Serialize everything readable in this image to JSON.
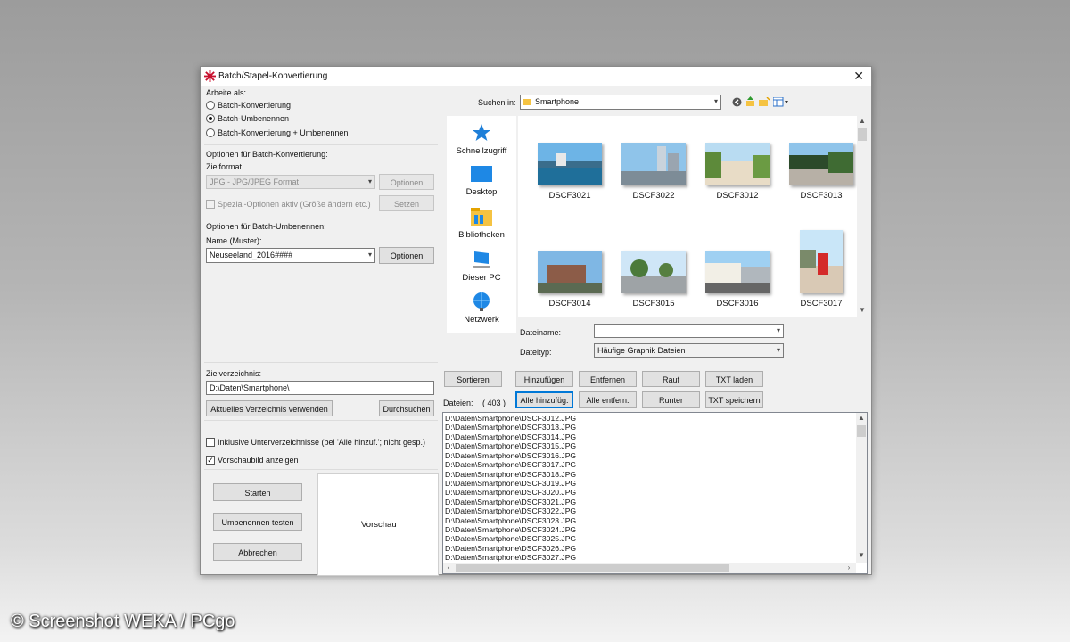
{
  "window": {
    "title": "Batch/Stapel-Konvertierung"
  },
  "mode": {
    "label": "Arbeite als:",
    "options": [
      "Batch-Konvertierung",
      "Batch-Umbenennen",
      "Batch-Konvertierung + Umbenennen"
    ],
    "selected": "Batch-Umbenennen"
  },
  "conversion": {
    "group_label": "Optionen für Batch-Konvertierung:",
    "format_label": "Zielformat",
    "format_value": "JPG - JPG/JPEG Format",
    "options_button": "Optionen",
    "special_label": "Spezial-Optionen aktiv (Größe ändern etc.)",
    "set_button": "Setzen"
  },
  "rename": {
    "group_label": "Optionen für Batch-Umbenennen:",
    "name_label": "Name (Muster):",
    "name_value": "Neuseeland_2016####",
    "options_button": "Optionen"
  },
  "target": {
    "label": "Zielverzeichnis:",
    "path": "D:\\Daten\\Smartphone\\",
    "use_current_button": "Aktuelles Verzeichnis verwenden",
    "browse_button": "Durchsuchen"
  },
  "checkboxes": {
    "include_sub": "Inklusive Unterverzeichnisse (bei 'Alle hinzuf.'; nicht gesp.)",
    "show_preview": "Vorschaubild anzeigen"
  },
  "actions": {
    "start": "Starten",
    "test_rename": "Umbenennen testen",
    "cancel": "Abbrechen"
  },
  "preview_label": "Vorschau",
  "browser": {
    "look_in_label": "Suchen in:",
    "look_in_value": "Smartphone",
    "places": [
      "Schnellzugriff",
      "Desktop",
      "Bibliotheken",
      "Dieser PC",
      "Netzwerk"
    ],
    "thumbnails": [
      "DSCF3021",
      "DSCF3022",
      "DSCF3012",
      "DSCF3013",
      "DSCF3014",
      "DSCF3015",
      "DSCF3016",
      "DSCF3017"
    ],
    "filename_label": "Dateiname:",
    "filename_value": "",
    "filetype_label": "Dateityp:",
    "filetype_value": "Häufige Graphik Dateien"
  },
  "list_buttons": {
    "sort": "Sortieren",
    "add": "Hinzufügen",
    "remove": "Entfernen",
    "up": "Rauf",
    "load_txt": "TXT laden",
    "add_all": "Alle hinzufüg.",
    "remove_all": "Alle entfern.",
    "down": "Runter",
    "save_txt": "TXT speichern"
  },
  "files": {
    "label": "Dateien:",
    "count": "( 403 )",
    "items": [
      "D:\\Daten\\Smartphone\\DSCF3012.JPG",
      "D:\\Daten\\Smartphone\\DSCF3013.JPG",
      "D:\\Daten\\Smartphone\\DSCF3014.JPG",
      "D:\\Daten\\Smartphone\\DSCF3015.JPG",
      "D:\\Daten\\Smartphone\\DSCF3016.JPG",
      "D:\\Daten\\Smartphone\\DSCF3017.JPG",
      "D:\\Daten\\Smartphone\\DSCF3018.JPG",
      "D:\\Daten\\Smartphone\\DSCF3019.JPG",
      "D:\\Daten\\Smartphone\\DSCF3020.JPG",
      "D:\\Daten\\Smartphone\\DSCF3021.JPG",
      "D:\\Daten\\Smartphone\\DSCF3022.JPG",
      "D:\\Daten\\Smartphone\\DSCF3023.JPG",
      "D:\\Daten\\Smartphone\\DSCF3024.JPG",
      "D:\\Daten\\Smartphone\\DSCF3025.JPG",
      "D:\\Daten\\Smartphone\\DSCF3026.JPG",
      "D:\\Daten\\Smartphone\\DSCF3027.JPG"
    ]
  },
  "watermark": "© Screenshot WEKA / PCgo",
  "colors": {
    "accent": "#0078d7",
    "star": "#1e7fd8",
    "folder": "#f5c342"
  }
}
